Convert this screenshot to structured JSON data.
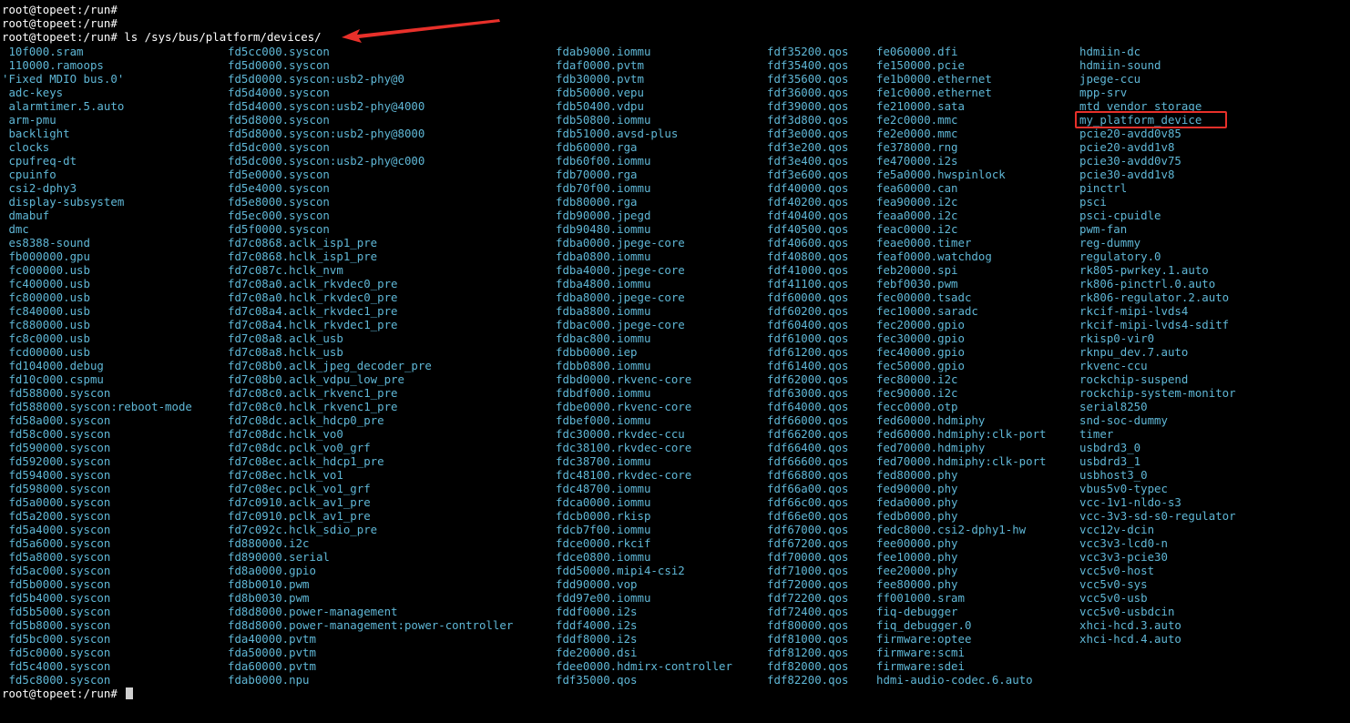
{
  "terminal": {
    "prompt_lines": [
      "root@topeet:/run#",
      "root@topeet:/run#"
    ],
    "command_prompt": "root@topeet:/run#",
    "command": " ls /sys/bus/platform/devices/",
    "final_prompt": "root@topeet:/run# ",
    "highlighted_entry": "my_platform_device",
    "colors": {
      "background": "#000000",
      "text": "#ffffff",
      "entry": "#5fb7d6",
      "annotation": "#e8302a"
    },
    "columns": [
      [
        " 10f000.sram",
        " 110000.ramoops",
        "'Fixed MDIO bus.0'",
        " adc-keys",
        " alarmtimer.5.auto",
        " arm-pmu",
        " backlight",
        " clocks",
        " cpufreq-dt",
        " cpuinfo",
        " csi2-dphy3",
        " display-subsystem",
        " dmabuf",
        " dmc",
        " es8388-sound",
        " fb000000.gpu",
        " fc000000.usb",
        " fc400000.usb",
        " fc800000.usb",
        " fc840000.usb",
        " fc880000.usb",
        " fc8c0000.usb",
        " fcd00000.usb",
        " fd104000.debug",
        " fd10c000.cspmu",
        " fd588000.syscon",
        " fd588000.syscon:reboot-mode",
        " fd58a000.syscon",
        " fd58c000.syscon",
        " fd590000.syscon",
        " fd592000.syscon",
        " fd594000.syscon",
        " fd598000.syscon",
        " fd5a0000.syscon",
        " fd5a2000.syscon",
        " fd5a4000.syscon",
        " fd5a6000.syscon",
        " fd5a8000.syscon",
        " fd5ac000.syscon",
        " fd5b0000.syscon",
        " fd5b4000.syscon",
        " fd5b5000.syscon",
        " fd5b8000.syscon",
        " fd5bc000.syscon",
        " fd5c0000.syscon",
        " fd5c4000.syscon",
        " fd5c8000.syscon"
      ],
      [
        "fd5cc000.syscon",
        "fd5d0000.syscon",
        "fd5d0000.syscon:usb2-phy@0",
        "fd5d4000.syscon",
        "fd5d4000.syscon:usb2-phy@4000",
        "fd5d8000.syscon",
        "fd5d8000.syscon:usb2-phy@8000",
        "fd5dc000.syscon",
        "fd5dc000.syscon:usb2-phy@c000",
        "fd5e0000.syscon",
        "fd5e4000.syscon",
        "fd5e8000.syscon",
        "fd5ec000.syscon",
        "fd5f0000.syscon",
        "fd7c0868.aclk_isp1_pre",
        "fd7c0868.hclk_isp1_pre",
        "fd7c087c.hclk_nvm",
        "fd7c08a0.aclk_rkvdec0_pre",
        "fd7c08a0.hclk_rkvdec0_pre",
        "fd7c08a4.aclk_rkvdec1_pre",
        "fd7c08a4.hclk_rkvdec1_pre",
        "fd7c08a8.aclk_usb",
        "fd7c08a8.hclk_usb",
        "fd7c08b0.aclk_jpeg_decoder_pre",
        "fd7c08b0.aclk_vdpu_low_pre",
        "fd7c08c0.aclk_rkvenc1_pre",
        "fd7c08c0.hclk_rkvenc1_pre",
        "fd7c08dc.aclk_hdcp0_pre",
        "fd7c08dc.hclk_vo0",
        "fd7c08dc.pclk_vo0_grf",
        "fd7c08ec.aclk_hdcp1_pre",
        "fd7c08ec.hclk_vo1",
        "fd7c08ec.pclk_vo1_grf",
        "fd7c0910.aclk_av1_pre",
        "fd7c0910.pclk_av1_pre",
        "fd7c092c.hclk_sdio_pre",
        "fd880000.i2c",
        "fd890000.serial",
        "fd8a0000.gpio",
        "fd8b0010.pwm",
        "fd8b0030.pwm",
        "fd8d8000.power-management",
        "fd8d8000.power-management:power-controller",
        "fda40000.pvtm",
        "fda50000.pvtm",
        "fda60000.pvtm",
        "fdab0000.npu"
      ],
      [
        "fdab9000.iommu",
        "fdaf0000.pvtm",
        "fdb30000.pvtm",
        "fdb50000.vepu",
        "fdb50400.vdpu",
        "fdb50800.iommu",
        "fdb51000.avsd-plus",
        "fdb60000.rga",
        "fdb60f00.iommu",
        "fdb70000.rga",
        "fdb70f00.iommu",
        "fdb80000.rga",
        "fdb90000.jpegd",
        "fdb90480.iommu",
        "fdba0000.jpege-core",
        "fdba0800.iommu",
        "fdba4000.jpege-core",
        "fdba4800.iommu",
        "fdba8000.jpege-core",
        "fdba8800.iommu",
        "fdbac000.jpege-core",
        "fdbac800.iommu",
        "fdbb0000.iep",
        "fdbb0800.iommu",
        "fdbd0000.rkvenc-core",
        "fdbdf000.iommu",
        "fdbe0000.rkvenc-core",
        "fdbef000.iommu",
        "fdc30000.rkvdec-ccu",
        "fdc38100.rkvdec-core",
        "fdc38700.iommu",
        "fdc48100.rkvdec-core",
        "fdc48700.iommu",
        "fdca0000.iommu",
        "fdcb0000.rkisp",
        "fdcb7f00.iommu",
        "fdce0000.rkcif",
        "fdce0800.iommu",
        "fdd50000.mipi4-csi2",
        "fdd90000.vop",
        "fdd97e00.iommu",
        "fddf0000.i2s",
        "fddf4000.i2s",
        "fddf8000.i2s",
        "fde20000.dsi",
        "fdee0000.hdmirx-controller",
        "fdf35000.qos"
      ],
      [
        "fdf35200.qos",
        "fdf35400.qos",
        "fdf35600.qos",
        "fdf36000.qos",
        "fdf39000.qos",
        "fdf3d800.qos",
        "fdf3e000.qos",
        "fdf3e200.qos",
        "fdf3e400.qos",
        "fdf3e600.qos",
        "fdf40000.qos",
        "fdf40200.qos",
        "fdf40400.qos",
        "fdf40500.qos",
        "fdf40600.qos",
        "fdf40800.qos",
        "fdf41000.qos",
        "fdf41100.qos",
        "fdf60000.qos",
        "fdf60200.qos",
        "fdf60400.qos",
        "fdf61000.qos",
        "fdf61200.qos",
        "fdf61400.qos",
        "fdf62000.qos",
        "fdf63000.qos",
        "fdf64000.qos",
        "fdf66000.qos",
        "fdf66200.qos",
        "fdf66400.qos",
        "fdf66600.qos",
        "fdf66800.qos",
        "fdf66a00.qos",
        "fdf66c00.qos",
        "fdf66e00.qos",
        "fdf67000.qos",
        "fdf67200.qos",
        "fdf70000.qos",
        "fdf71000.qos",
        "fdf72000.qos",
        "fdf72200.qos",
        "fdf72400.qos",
        "fdf80000.qos",
        "fdf81000.qos",
        "fdf81200.qos",
        "fdf82000.qos",
        "fdf82200.qos"
      ],
      [
        "fe060000.dfi",
        "fe150000.pcie",
        "fe1b0000.ethernet",
        "fe1c0000.ethernet",
        "fe210000.sata",
        "fe2c0000.mmc",
        "fe2e0000.mmc",
        "fe378000.rng",
        "fe470000.i2s",
        "fe5a0000.hwspinlock",
        "fea60000.can",
        "fea90000.i2c",
        "feaa0000.i2c",
        "feac0000.i2c",
        "feae0000.timer",
        "feaf0000.watchdog",
        "feb20000.spi",
        "febf0030.pwm",
        "fec00000.tsadc",
        "fec10000.saradc",
        "fec20000.gpio",
        "fec30000.gpio",
        "fec40000.gpio",
        "fec50000.gpio",
        "fec80000.i2c",
        "fec90000.i2c",
        "fecc0000.otp",
        "fed60000.hdmiphy",
        "fed60000.hdmiphy:clk-port",
        "fed70000.hdmiphy",
        "fed70000.hdmiphy:clk-port",
        "fed80000.phy",
        "fed90000.phy",
        "feda0000.phy",
        "fedb0000.phy",
        "fedc8000.csi2-dphy1-hw",
        "fee00000.phy",
        "fee10000.phy",
        "fee20000.phy",
        "fee80000.phy",
        "ff001000.sram",
        "fiq-debugger",
        "fiq_debugger.0",
        "firmware:optee",
        "firmware:scmi",
        "firmware:sdei",
        "hdmi-audio-codec.6.auto"
      ],
      [
        "hdmiin-dc",
        "hdmiin-sound",
        "jpege-ccu",
        "mpp-srv",
        "mtd_vendor_storage",
        "my_platform_device",
        "pcie20-avdd0v85",
        "pcie20-avdd1v8",
        "pcie30-avdd0v75",
        "pcie30-avdd1v8",
        "pinctrl",
        "psci",
        "psci-cpuidle",
        "pwm-fan",
        "reg-dummy",
        "regulatory.0",
        "rk805-pwrkey.1.auto",
        "rk806-pinctrl.0.auto",
        "rk806-regulator.2.auto",
        "rkcif-mipi-lvds4",
        "rkcif-mipi-lvds4-sditf",
        "rkisp0-vir0",
        "rknpu_dev.7.auto",
        "rkvenc-ccu",
        "rockchip-suspend",
        "rockchip-system-monitor",
        "serial8250",
        "snd-soc-dummy",
        "timer",
        "usbdrd3_0",
        "usbdrd3_1",
        "usbhost3_0",
        "vbus5v0-typec",
        "vcc-1v1-nldo-s3",
        "vcc-3v3-sd-s0-regulator",
        "vcc12v-dcin",
        "vcc3v3-lcd0-n",
        "vcc3v3-pcie30",
        "vcc5v0-host",
        "vcc5v0-sys",
        "vcc5v0-usb",
        "vcc5v0-usbdcin",
        "xhci-hcd.3.auto",
        "xhci-hcd.4.auto"
      ]
    ]
  }
}
